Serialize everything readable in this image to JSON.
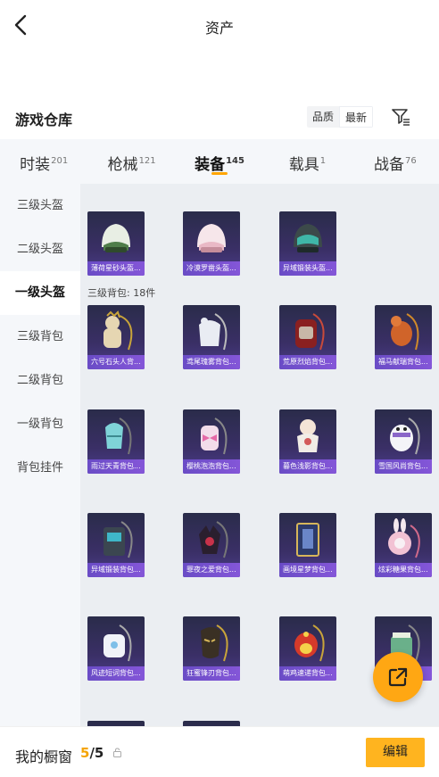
{
  "header": {
    "title": "资产"
  },
  "warehouse": {
    "title": "游戏仓库",
    "sort_options": [
      "品质",
      "最新"
    ],
    "active_sort": 1
  },
  "tabs": [
    {
      "label": "时装",
      "count": "201",
      "active": false
    },
    {
      "label": "枪械",
      "count": "121",
      "active": false
    },
    {
      "label": "装备",
      "count": "145",
      "active": true
    },
    {
      "label": "载具",
      "count": "1",
      "active": false
    },
    {
      "label": "战备",
      "count": "76",
      "active": false
    }
  ],
  "sidebar": {
    "items": [
      {
        "label": "三级头盔",
        "active": false
      },
      {
        "label": "二级头盔",
        "active": false
      },
      {
        "label": "一级头盔",
        "active": true
      },
      {
        "label": "三级背包",
        "active": false
      },
      {
        "label": "二级背包",
        "active": false
      },
      {
        "label": "一级背包",
        "active": false
      },
      {
        "label": "背包挂件",
        "active": false
      }
    ]
  },
  "grid": {
    "helmets": [
      {
        "name": "薄荷星砂头盔...",
        "art": "helmet-green"
      },
      {
        "name": "冷漠罗凿头盔...",
        "art": "helmet-pink"
      },
      {
        "name": "异域锻装头盔...",
        "art": "helmet-teal"
      }
    ],
    "backpack_section_label": "三级背包: 18件",
    "backpacks": [
      {
        "name": "六号石头人背...",
        "art": "bear-backpack"
      },
      {
        "name": "鸢尾瑰雾背包...",
        "art": "white-backpack"
      },
      {
        "name": "荒原烈焰背包...",
        "art": "red-backpack"
      },
      {
        "name": "福马献瑞背包...",
        "art": "horse-backpack"
      },
      {
        "name": "雨过天青背包...",
        "art": "cyan-backpack"
      },
      {
        "name": "樱桃泡泡背包...",
        "art": "bow-backpack"
      },
      {
        "name": "暮色浅影背包...",
        "art": "doll-backpack"
      },
      {
        "name": "雪国风尚背包...",
        "art": "penguin-backpack"
      },
      {
        "name": "异域锻装背包...",
        "art": "mech-backpack"
      },
      {
        "name": "罪夜之爱背包...",
        "art": "dark-backpack"
      },
      {
        "name": "画境星梦背包...",
        "art": "frame-backpack"
      },
      {
        "name": "炫彩糖果背包...",
        "art": "bunny-backpack"
      },
      {
        "name": "风迹短词背包...",
        "art": "cloud-backpack"
      },
      {
        "name": "狂蜜锋刃背包...",
        "art": "mask-backpack"
      },
      {
        "name": "萌鸡速递背包...",
        "art": "chick-backpack"
      },
      {
        "name": "",
        "art": "cash-backpack"
      }
    ]
  },
  "bottom": {
    "title": "我的橱窗",
    "current": "5",
    "separator": "/",
    "total": "5",
    "edit_label": "编辑"
  },
  "colors": {
    "accent": "#ffa713",
    "item_bg": "#3a2f66",
    "label_bg": "#6a4cc6"
  }
}
